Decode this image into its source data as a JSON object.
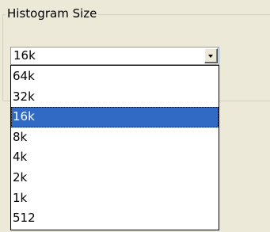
{
  "group": {
    "title": "Histogram Size"
  },
  "combo": {
    "value": "16k"
  },
  "dropdown": {
    "selected_index": 2,
    "items": [
      "64k",
      "32k",
      "16k",
      "8k",
      "4k",
      "2k",
      "1k",
      "512"
    ]
  },
  "icons": {
    "dropdown_arrow": "chevron-down-icon"
  },
  "colors": {
    "selection": "#316ac5",
    "background": "#ece9d8"
  }
}
